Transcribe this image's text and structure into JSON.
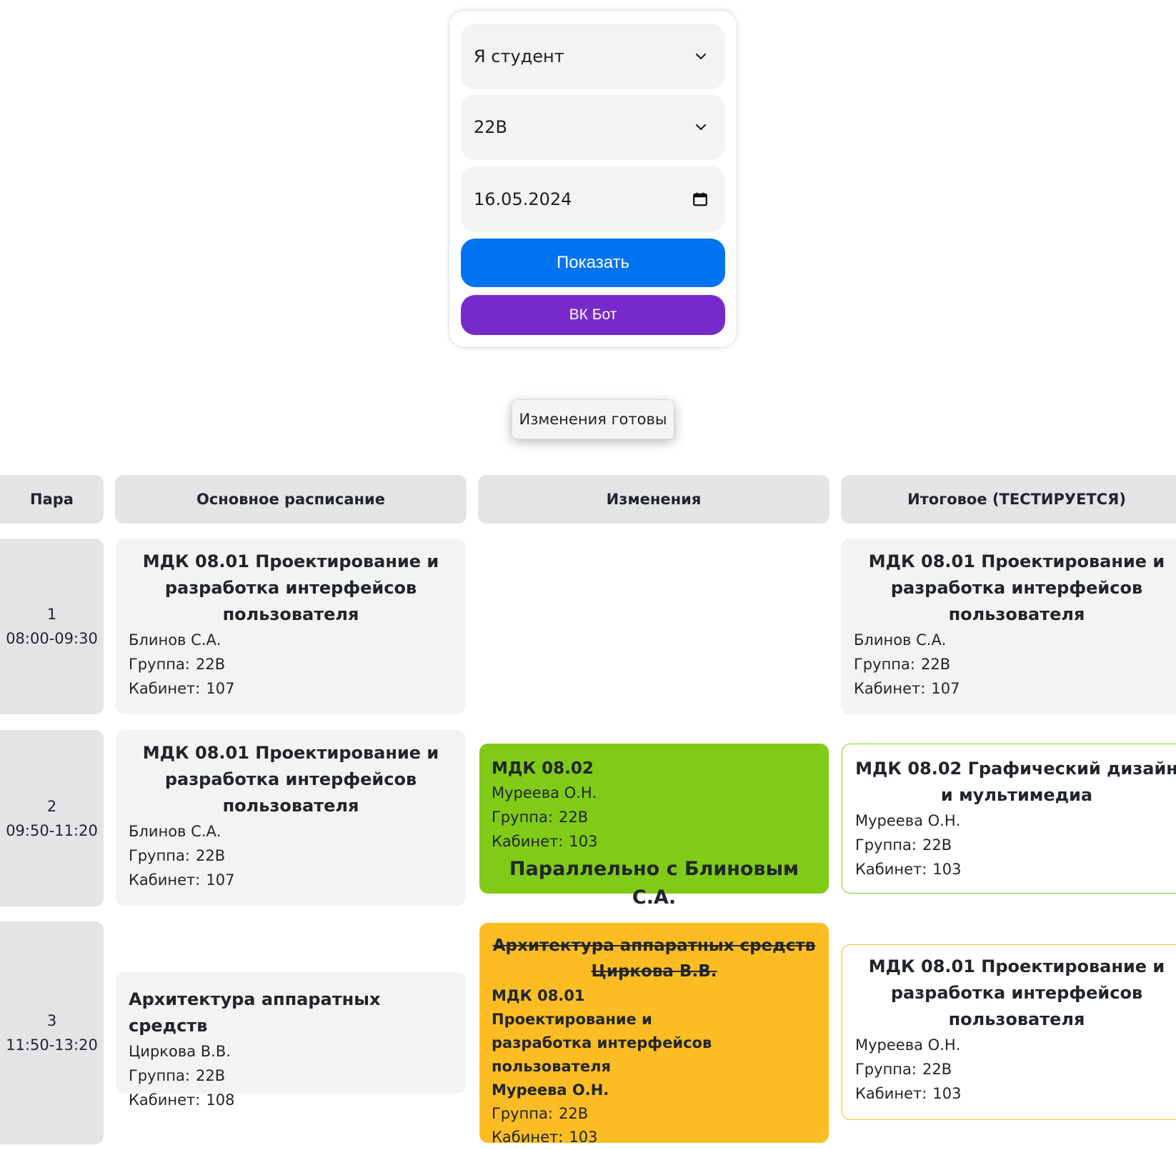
{
  "form": {
    "role_select": "Я студент",
    "group_select": "22В",
    "date_input": "16.05.2024",
    "show_button": "Показать",
    "vk_button": "ВК Бот"
  },
  "status": {
    "changes_ready": "Изменения готовы"
  },
  "table": {
    "headers": {
      "para": "Пара",
      "main": "Основное расписание",
      "changes": "Изменения",
      "final": "Итоговое (ТЕСТИРУЕТСЯ)"
    },
    "labels": {
      "group": "Группа:",
      "room": "Кабинет:"
    },
    "rows": [
      {
        "num": "1",
        "time": "08:00-09:30",
        "main": {
          "subject": "МДК 08.01 Проектирование и разработка интерфейсов пользователя",
          "teacher": "Блинов С.А.",
          "group": "22В",
          "room": "107"
        },
        "final": {
          "subject": "МДК 08.01 Проектирование и разработка интерфейсов пользователя",
          "teacher": "Блинов С.А.",
          "group": "22В",
          "room": "107"
        }
      },
      {
        "num": "2",
        "time": "09:50-11:20",
        "main": {
          "subject": "МДК 08.01 Проектирование и разработка интерфейсов пользователя",
          "teacher": "Блинов С.А.",
          "group": "22В",
          "room": "107"
        },
        "change": {
          "subject": "МДК 08.02",
          "teacher": "Муреева О.Н.",
          "group": "22В",
          "room": "103",
          "note": "Параллельно с Блиновым С.А."
        },
        "final": {
          "subject": "МДК 08.02 Графический дизайн и мультимедиа",
          "teacher": "Муреева О.Н.",
          "group": "22В",
          "room": "103"
        }
      },
      {
        "num": "3",
        "time": "11:50-13:20",
        "main": {
          "subject": "Архитектура аппаратных средств",
          "teacher": "Циркова В.В.",
          "group": "22В",
          "room": "108"
        },
        "change": {
          "old_subject": "Архитектура аппаратных средств",
          "old_teacher": "Циркова В.В.",
          "subject": "МДК 08.01 Проектирование и разработка интерфейсов пользователя",
          "teacher": "Муреева О.Н.",
          "group": "22В",
          "room": "103"
        },
        "final": {
          "subject": "МДК 08.01 Проектирование и разработка интерфейсов пользователя",
          "teacher": "Муреева О.Н.",
          "group": "22В",
          "room": "103"
        }
      }
    ]
  },
  "colors": {
    "primary_button": "#0074f0",
    "vk_button": "#7829cc",
    "change_green": "#7fcb15",
    "change_yellow": "#fbbd23",
    "cell_gray": "#f3f3f3",
    "header_gray": "#e4e4e7"
  },
  "icons": {
    "role_select": "chevron-down-icon",
    "group_select": "chevron-down-icon",
    "date_input": "calendar-icon"
  }
}
